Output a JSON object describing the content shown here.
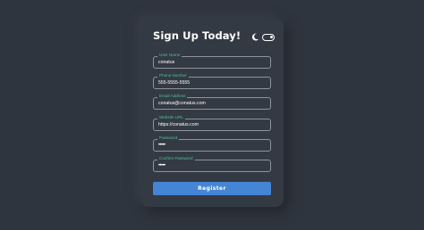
{
  "form": {
    "title": "Sign Up Today!",
    "fields": [
      {
        "label": "User Name",
        "value": "conatus"
      },
      {
        "label": "Phone Number",
        "value": "555-5555-5555"
      },
      {
        "label": "Email Address",
        "value": "conatus@conatus.com"
      },
      {
        "label": "Website URL",
        "value": "https://conatus.com"
      },
      {
        "label": "Password",
        "value": "•••••"
      },
      {
        "label": "Confirm Password",
        "value": "•••••"
      }
    ],
    "submit_label": "Register"
  },
  "theme": {
    "icon": "moon-icon",
    "toggle_state": "on"
  },
  "colors": {
    "background": "#2f353e",
    "card": "#333a43",
    "label_accent": "#4fbf95",
    "button": "#4585d6",
    "field_border": "#8d949d"
  }
}
